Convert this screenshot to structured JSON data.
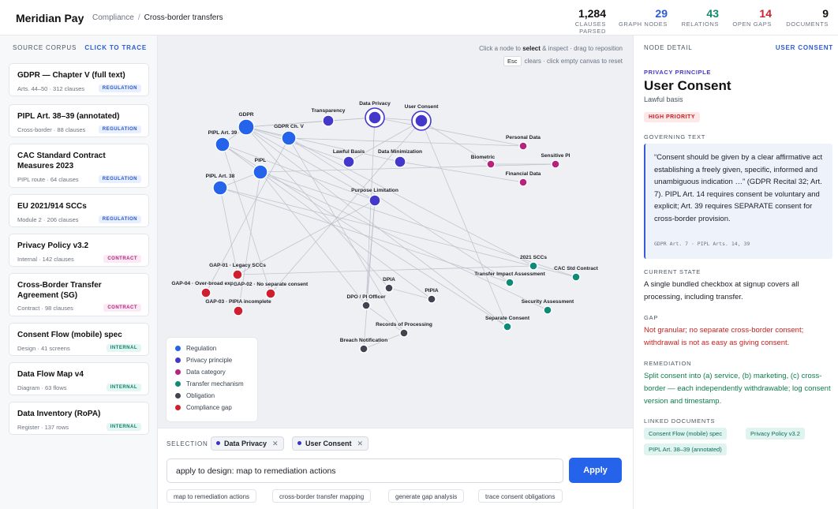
{
  "header": {
    "brand": "Meridian Pay",
    "breadcrumb": [
      "Compliance",
      "Cross-border transfers"
    ],
    "stats": [
      {
        "value": "1,284",
        "label": "CLAUSES PARSED",
        "color": "#111111"
      },
      {
        "value": "29",
        "label": "GRAPH NODES",
        "color": "#2a5bd7"
      },
      {
        "value": "43",
        "label": "RELATIONS",
        "color": "#0f8a6b"
      },
      {
        "value": "14",
        "label": "OPEN GAPS",
        "color": "#d01f2f"
      },
      {
        "value": "9",
        "label": "DOCUMENTS",
        "color": "#111111"
      }
    ]
  },
  "sidebar": {
    "title": "SOURCE CORPUS",
    "action": "CLICK TO TRACE",
    "documents": [
      {
        "title": "GDPR — Chapter V (full text)",
        "meta": "Arts. 44–50 · 312 clauses",
        "tag": "REGULATION"
      },
      {
        "title": "PIPL Art. 38–39 (annotated)",
        "meta": "Cross-border · 88 clauses",
        "tag": "REGULATION"
      },
      {
        "title": "CAC Standard Contract Measures 2023",
        "meta": "PIPL route · 64 clauses",
        "tag": "REGULATION"
      },
      {
        "title": "EU 2021/914 SCCs",
        "meta": "Module 2 · 206 clauses",
        "tag": "REGULATION"
      },
      {
        "title": "Privacy Policy v3.2",
        "meta": "Internal · 142 clauses",
        "tag": "CONTRACT"
      },
      {
        "title": "Cross-Border Transfer Agreement (SG)",
        "meta": "Contract · 98 clauses",
        "tag": "CONTRACT"
      },
      {
        "title": "Consent Flow (mobile) spec",
        "meta": "Design · 41 screens",
        "tag": "INTERNAL"
      },
      {
        "title": "Data Flow Map v4",
        "meta": "Diagram · 63 flows",
        "tag": "INTERNAL"
      },
      {
        "title": "Data Inventory (RoPA)",
        "meta": "Register · 137 rows",
        "tag": "INTERNAL"
      }
    ]
  },
  "canvas": {
    "hint_prefix": "Click a node to",
    "hint_bold": "select",
    "hint_suffix": "& inspect · drag to reposition",
    "key": "Esc",
    "key_hint": "clears · click empty canvas to reset",
    "colors": {
      "regulation": "#2563eb",
      "principle": "#4338ca",
      "category": "#b5237f",
      "mechanism": "#0f8a76",
      "obligation": "#3f4450",
      "gap": "#d01f2f"
    },
    "legend": [
      {
        "label": "Regulation",
        "type": "regulation"
      },
      {
        "label": "Privacy principle",
        "type": "principle"
      },
      {
        "label": "Data category",
        "type": "category"
      },
      {
        "label": "Transfer mechanism",
        "type": "mechanism"
      },
      {
        "label": "Obligation",
        "type": "obligation"
      },
      {
        "label": "Compliance gap",
        "type": "gap"
      }
    ],
    "nodes": [
      {
        "id": "gdpr",
        "label": "GDPR",
        "type": "regulation"
      },
      {
        "id": "gdpr5",
        "label": "GDPR Ch. V",
        "type": "regulation"
      },
      {
        "id": "pipl39",
        "label": "PIPL Art. 39",
        "type": "regulation"
      },
      {
        "id": "pipl",
        "label": "PIPL",
        "type": "regulation"
      },
      {
        "id": "pipl38",
        "label": "PIPL Art. 38",
        "type": "regulation"
      },
      {
        "id": "transp",
        "label": "Transparency",
        "type": "principle"
      },
      {
        "id": "dataprivacy",
        "label": "Data Privacy",
        "type": "principle",
        "selected": true
      },
      {
        "id": "consent",
        "label": "User Consent",
        "type": "principle",
        "selected": true
      },
      {
        "id": "lawful",
        "label": "Lawful Basis",
        "type": "principle"
      },
      {
        "id": "datamin",
        "label": "Data Minimization",
        "type": "principle"
      },
      {
        "id": "purpose",
        "label": "Purpose Limitation",
        "type": "principle"
      },
      {
        "id": "personal",
        "label": "Personal Data",
        "type": "category"
      },
      {
        "id": "biometric",
        "label": "Biometric",
        "type": "category"
      },
      {
        "id": "sensitive",
        "label": "Sensitive PI",
        "type": "category"
      },
      {
        "id": "financial",
        "label": "Financial Data",
        "type": "category"
      },
      {
        "id": "scc2021",
        "label": "2021 SCCs",
        "type": "mechanism"
      },
      {
        "id": "cac",
        "label": "CAC Std Contract",
        "type": "mechanism"
      },
      {
        "id": "tia",
        "label": "Transfer Impact Assessment",
        "type": "mechanism"
      },
      {
        "id": "secassess",
        "label": "Security Assessment",
        "type": "mechanism"
      },
      {
        "id": "sepconsent",
        "label": "Separate Consent",
        "type": "mechanism"
      },
      {
        "id": "dpia",
        "label": "DPIA",
        "type": "obligation"
      },
      {
        "id": "pipia",
        "label": "PIPIA",
        "type": "obligation"
      },
      {
        "id": "dpo",
        "label": "DPO / PI Officer",
        "type": "obligation"
      },
      {
        "id": "records",
        "label": "Records of Processing",
        "type": "obligation"
      },
      {
        "id": "breach",
        "label": "Breach Notification",
        "type": "obligation"
      },
      {
        "id": "gap01",
        "label": "GAP-01 · Legacy SCCs",
        "type": "gap"
      },
      {
        "id": "gap04",
        "label": "GAP-04 · Over-broad export",
        "type": "gap"
      },
      {
        "id": "gap02",
        "label": "GAP-02 · No separate consent",
        "type": "gap"
      },
      {
        "id": "gap03",
        "label": "GAP-03 · PIPIA incomplete",
        "type": "gap"
      }
    ],
    "edges": [
      [
        "gdpr",
        "gdpr5"
      ],
      [
        "gdpr",
        "pipl39"
      ],
      [
        "gdpr",
        "dataprivacy"
      ],
      [
        "gdpr",
        "transp"
      ],
      [
        "gdpr",
        "lawful"
      ],
      [
        "gdpr",
        "datamin"
      ],
      [
        "gdpr",
        "purpose"
      ],
      [
        "gdpr",
        "dpia"
      ],
      [
        "gdpr",
        "sepconsent"
      ],
      [
        "gdpr5",
        "scc2021"
      ],
      [
        "gdpr5",
        "tia"
      ],
      [
        "gdpr5",
        "personal"
      ],
      [
        "gdpr5",
        "records"
      ],
      [
        "gdpr5",
        "gap04"
      ],
      [
        "pipl39",
        "pipl"
      ],
      [
        "pipl39",
        "sepconsent"
      ],
      [
        "pipl39",
        "gap02"
      ],
      [
        "pipl39",
        "purpose"
      ],
      [
        "pipl",
        "pipl38"
      ],
      [
        "pipl",
        "cac"
      ],
      [
        "pipl",
        "secassess"
      ],
      [
        "pipl",
        "pipia"
      ],
      [
        "pipl",
        "dpo"
      ],
      [
        "pipl",
        "sensitive"
      ],
      [
        "pipl",
        "gap03"
      ],
      [
        "pipl38",
        "gap01"
      ],
      [
        "pipl38",
        "tia"
      ],
      [
        "pipl38",
        "cac"
      ],
      [
        "dataprivacy",
        "consent"
      ],
      [
        "dataprivacy",
        "transp"
      ],
      [
        "dataprivacy",
        "personal"
      ],
      [
        "dataprivacy",
        "dpo"
      ],
      [
        "consent",
        "sepconsent"
      ],
      [
        "consent",
        "lawful"
      ],
      [
        "consent",
        "gap02"
      ],
      [
        "consent",
        "biometric"
      ],
      [
        "purpose",
        "dpo"
      ],
      [
        "purpose",
        "gap01"
      ],
      [
        "purpose",
        "breach"
      ],
      [
        "datamin",
        "financial"
      ],
      [
        "biometric",
        "sensitive"
      ],
      [
        "scc2021",
        "gap01"
      ],
      [
        "dpia",
        "pipia"
      ],
      [
        "records",
        "breach"
      ],
      [
        "dpo",
        "records"
      ]
    ]
  },
  "selection": {
    "label": "SELECTION",
    "chips": [
      "Data Privacy",
      "User Consent"
    ],
    "query": "apply to design: map to remediation actions",
    "apply_label": "Apply",
    "suggestions": [
      "map to remediation actions",
      "cross-border transfer mapping",
      "generate gap analysis",
      "trace consent obligations"
    ]
  },
  "detail": {
    "head": "NODE DETAIL",
    "head_link": "USER CONSENT",
    "kicker": "PRIVACY PRINCIPLE",
    "title": "User Consent",
    "subtitle": "Lawful basis",
    "priority": "HIGH PRIORITY",
    "governing_label": "GOVERNING TEXT",
    "governing_text": "“Consent should be given by a clear affirmative act establishing a freely given, specific, informed and unambiguous indication …” (GDPR Recital 32; Art. 7). PIPL Art. 14 requires consent be voluntary and explicit; Art. 39 requires SEPARATE consent for cross-border provision.",
    "governing_ref": "GDPR Art. 7 · PIPL Arts. 14, 39",
    "current_label": "CURRENT STATE",
    "current_text": "A single bundled checkbox at signup covers all processing, including transfer.",
    "gap_label": "GAP",
    "gap_text": "Not granular; no separate cross-border consent; withdrawal is not as easy as giving consent.",
    "remediation_label": "REMEDIATION",
    "remediation_text": "Split consent into (a) service, (b) marketing, (c) cross-border — each independently withdrawable; log consent version and timestamp.",
    "linked_label": "LINKED DOCUMENTS",
    "linked": [
      "Consent Flow (mobile) spec",
      "Privacy Policy v3.2",
      "PIPL Art. 38–39 (annotated)"
    ]
  }
}
